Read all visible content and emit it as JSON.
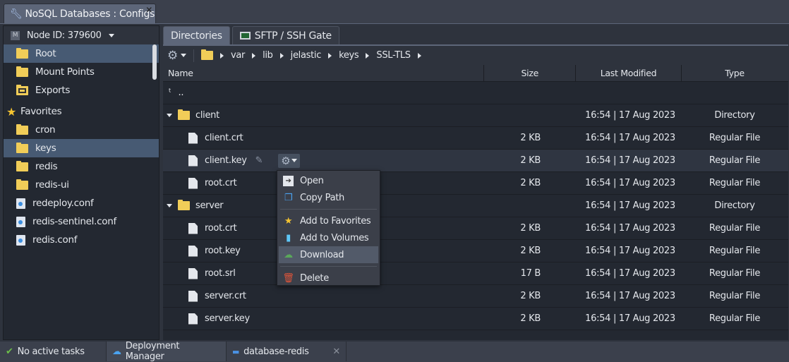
{
  "window": {
    "title": "NoSQL Databases : Configs",
    "close": "✕"
  },
  "sidebar": {
    "node": "Node ID: 379600",
    "node_badge": "M",
    "items": [
      {
        "label": "Root",
        "icon": "folder-icon",
        "selected": true
      },
      {
        "label": "Mount Points",
        "icon": "mount-folder-icon"
      },
      {
        "label": "Exports",
        "icon": "export-folder-icon"
      }
    ],
    "favorites_label": "Favorites",
    "favorites": [
      {
        "label": "cron",
        "icon": "folder-icon"
      },
      {
        "label": "keys",
        "icon": "folder-icon",
        "selected": true
      },
      {
        "label": "redis",
        "icon": "folder-icon"
      },
      {
        "label": "redis-ui",
        "icon": "folder-icon"
      },
      {
        "label": "redeploy.conf",
        "icon": "config-file-icon"
      },
      {
        "label": "redis-sentinel.conf",
        "icon": "config-file-icon"
      },
      {
        "label": "redis.conf",
        "icon": "config-file-icon"
      }
    ]
  },
  "tabs": [
    {
      "label": "Directories",
      "active": true
    },
    {
      "label": "SFTP / SSH Gate"
    }
  ],
  "breadcrumb": [
    "var",
    "lib",
    "jelastic",
    "keys",
    "SSL-TLS"
  ],
  "columns": {
    "name": "Name",
    "size": "Size",
    "modified": "Last Modified",
    "type": "Type"
  },
  "up": "..",
  "rows": [
    {
      "name": "client",
      "kind": "dir",
      "indent": 0,
      "size": "",
      "modified": "16:54 | 17 Aug 2023",
      "type": "Directory"
    },
    {
      "name": "client.crt",
      "kind": "file",
      "indent": 1,
      "size": "2 KB",
      "modified": "16:54 | 17 Aug 2023",
      "type": "Regular File"
    },
    {
      "name": "client.key",
      "kind": "file",
      "indent": 1,
      "size": "2 KB",
      "modified": "16:54 | 17 Aug 2023",
      "type": "Regular File",
      "hover": true
    },
    {
      "name": "root.crt",
      "kind": "file",
      "indent": 1,
      "size": "2 KB",
      "modified": "16:54 | 17 Aug 2023",
      "type": "Regular File"
    },
    {
      "name": "server",
      "kind": "dir",
      "indent": 0,
      "size": "",
      "modified": "16:54 | 17 Aug 2023",
      "type": "Directory"
    },
    {
      "name": "root.crt",
      "kind": "file",
      "indent": 1,
      "size": "2 KB",
      "modified": "16:54 | 17 Aug 2023",
      "type": "Regular File"
    },
    {
      "name": "root.key",
      "kind": "file",
      "indent": 1,
      "size": "2 KB",
      "modified": "16:54 | 17 Aug 2023",
      "type": "Regular File"
    },
    {
      "name": "root.srl",
      "kind": "file",
      "indent": 1,
      "size": "17 B",
      "modified": "16:54 | 17 Aug 2023",
      "type": "Regular File"
    },
    {
      "name": "server.crt",
      "kind": "file",
      "indent": 1,
      "size": "2 KB",
      "modified": "16:54 | 17 Aug 2023",
      "type": "Regular File"
    },
    {
      "name": "server.key",
      "kind": "file",
      "indent": 1,
      "size": "2 KB",
      "modified": "16:54 | 17 Aug 2023",
      "type": "Regular File"
    }
  ],
  "context_menu": [
    {
      "label": "Open",
      "icon": "open-icon"
    },
    {
      "label": "Copy Path",
      "icon": "copy-icon"
    },
    {
      "sep": true
    },
    {
      "label": "Add to Favorites",
      "icon": "star-icon"
    },
    {
      "label": "Add to Volumes",
      "icon": "volume-icon"
    },
    {
      "label": "Download",
      "icon": "download-icon",
      "hover": true
    },
    {
      "sep": true
    },
    {
      "label": "Delete",
      "icon": "trash-icon"
    }
  ],
  "status": {
    "tasks": "No active tasks",
    "deployment": "Deployment Manager",
    "env": "database-redis"
  },
  "colors": {
    "accent": "#5d6679",
    "selection": "#475a73",
    "folder": "#f1cd58"
  }
}
